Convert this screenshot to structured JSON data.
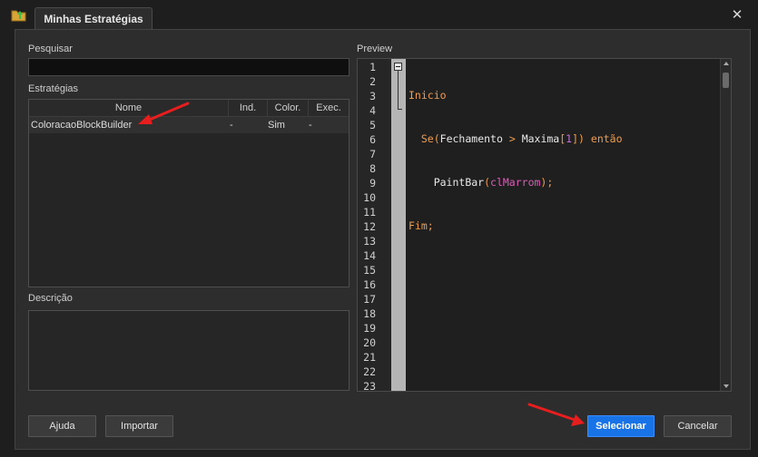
{
  "window": {
    "tab_title": "Minhas Estratégias",
    "close_glyph": "✕"
  },
  "left": {
    "search_label": "Pesquisar",
    "search_value": "",
    "strategies_label": "Estratégias",
    "columns": [
      "Nome",
      "Ind.",
      "Color.",
      "Exec."
    ],
    "rows": [
      {
        "nome": "ColoracaoBlockBuilder",
        "ind": "-",
        "color": "Sim",
        "exec": "-"
      }
    ],
    "description_label": "Descrição"
  },
  "preview": {
    "label": "Preview",
    "line_numbers": [
      "1",
      "2",
      "3",
      "4",
      "5",
      "6",
      "7",
      "8",
      "9",
      "10",
      "11",
      "12",
      "13",
      "14",
      "15",
      "16",
      "17",
      "18",
      "19",
      "20",
      "21",
      "22",
      "23"
    ],
    "code": {
      "l1_kw": "Inicio",
      "l2_se": "Se",
      "l2_open": "(",
      "l2_fech": "Fechamento",
      "l2_gt": " > ",
      "l2_max": "Maxima",
      "l2_br1": "[",
      "l2_num": "1",
      "l2_br2": "])",
      "l2_entao": " então",
      "l3_fn": "PaintBar",
      "l3_open": "(",
      "l3_const": "clMarrom",
      "l3_close": ");",
      "l4_kw": "Fim",
      "l4_semi": ";"
    }
  },
  "buttons": {
    "help": "Ajuda",
    "import": "Importar",
    "select": "Selecionar",
    "cancel": "Cancelar"
  },
  "colors": {
    "accent": "#1873e6",
    "annotation_arrow": "#e81e1e"
  },
  "icons": {
    "app": "folder-arrow-icon",
    "fold": "fold-minus-icon"
  }
}
